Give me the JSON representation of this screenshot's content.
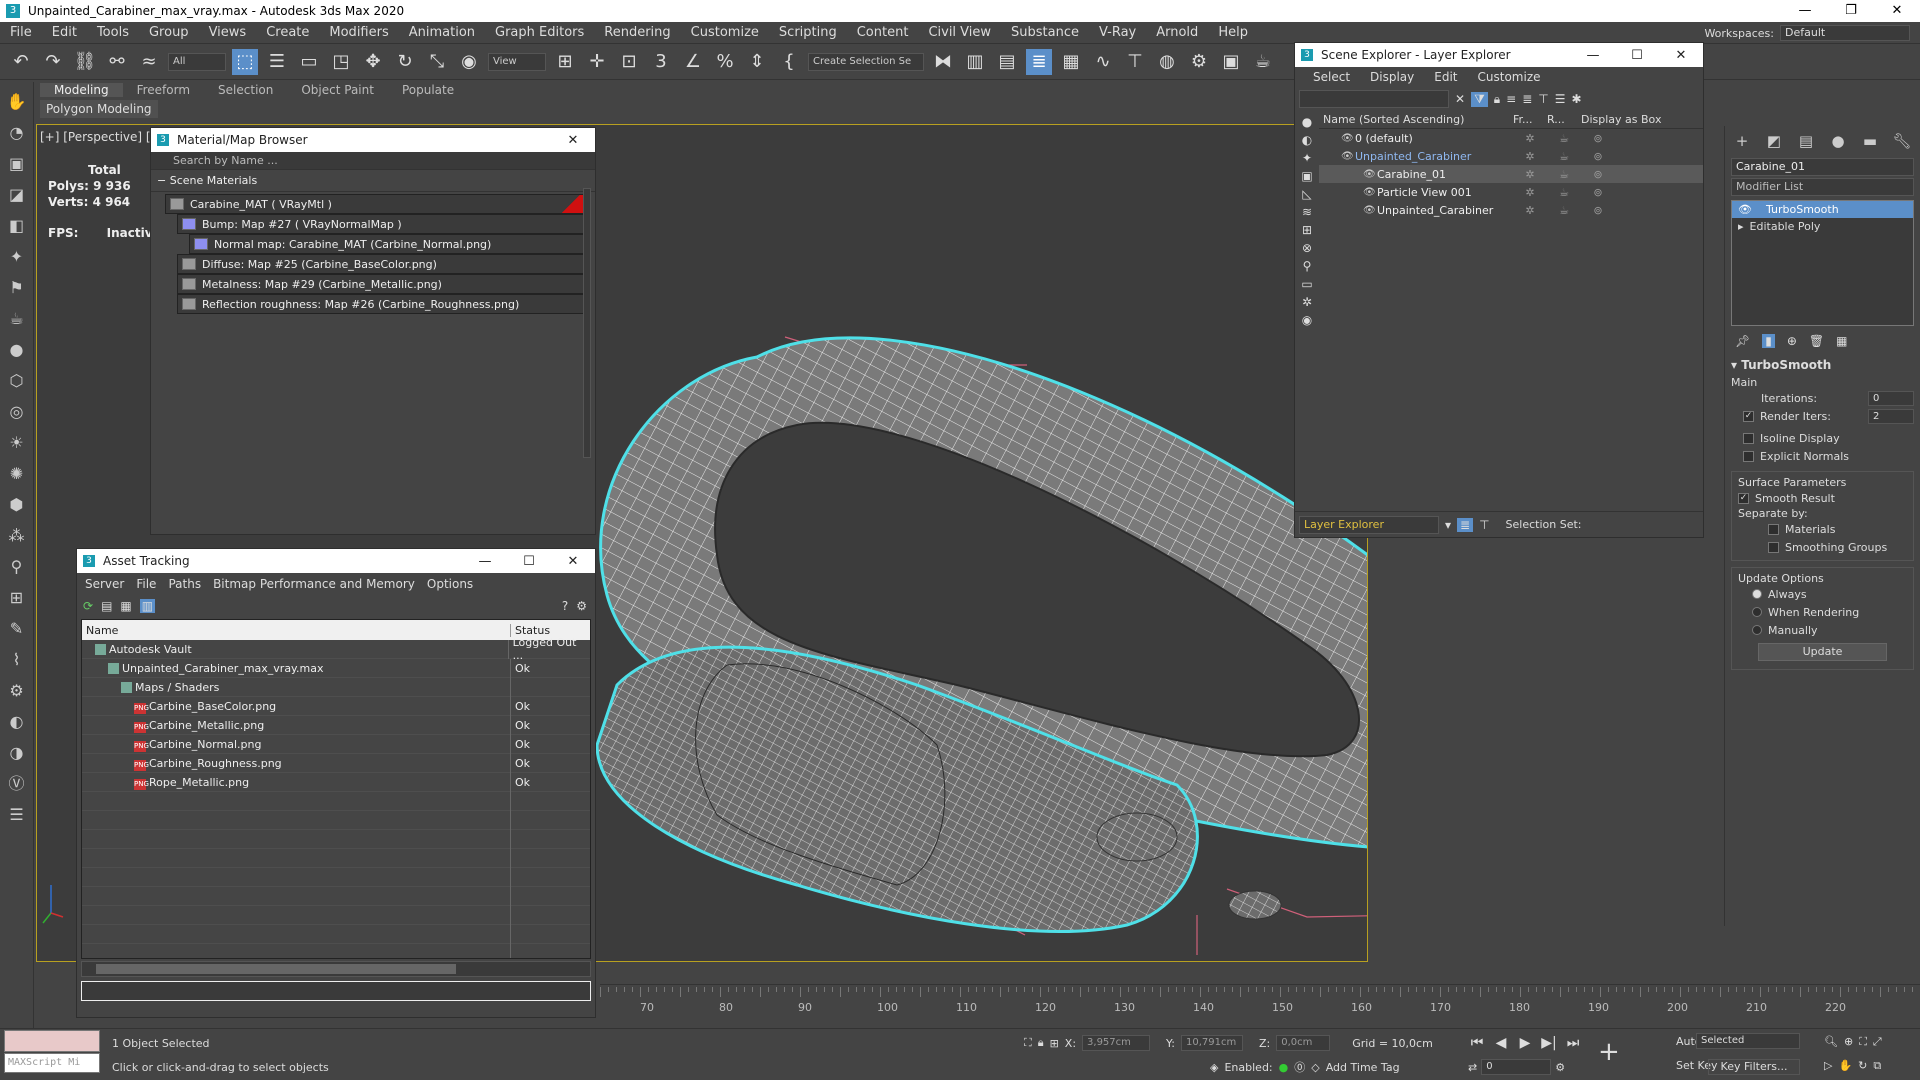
{
  "title": "Unpainted_Carabiner_max_vray.max - Autodesk 3ds Max 2020",
  "menu": [
    "File",
    "Edit",
    "Tools",
    "Group",
    "Views",
    "Create",
    "Modifiers",
    "Animation",
    "Graph Editors",
    "Rendering",
    "Customize",
    "Scripting",
    "Content",
    "Civil View",
    "Substance",
    "V-Ray",
    "Arnold",
    "Help"
  ],
  "workspace": {
    "label": "Workspaces:",
    "value": "Default"
  },
  "toolbar": {
    "filter": "All",
    "view": "View",
    "selection_set": "Create Selection Se"
  },
  "ribbon": {
    "tabs": [
      "Modeling",
      "Freeform",
      "Selection",
      "Object Paint",
      "Populate"
    ],
    "active": "Modeling",
    "sub": "Polygon Modeling"
  },
  "viewport": {
    "label": "[+] [Perspective] [St",
    "stats_total": "Total",
    "polys_label": "Polys:",
    "polys": "9 936",
    "verts_label": "Verts:",
    "verts": "4 964",
    "fps_label": "FPS:",
    "fps": "Inactive"
  },
  "material_browser": {
    "title": "Material/Map Browser",
    "search": "Search by Name ...",
    "section": "Scene Materials",
    "items": [
      {
        "label": "Carabine_MAT  ( VRayMtl )",
        "indent": 0
      },
      {
        "label": "Bump: Map #27  ( VRayNormalMap )",
        "indent": 1
      },
      {
        "label": "Normal map: Carabine_MAT (Carbine_Normal.png)",
        "indent": 2
      },
      {
        "label": "Diffuse: Map #25 (Carbine_BaseColor.png)",
        "indent": 1
      },
      {
        "label": "Metalness: Map #29 (Carbine_Metallic.png)",
        "indent": 1
      },
      {
        "label": "Reflection roughness: Map #26 (Carbine_Roughness.png)",
        "indent": 1
      }
    ]
  },
  "asset_tracking": {
    "title": "Asset Tracking",
    "menu": [
      "Server",
      "File",
      "Paths",
      "Bitmap Performance and Memory",
      "Options"
    ],
    "col_name": "Name",
    "col_status": "Status",
    "rows": [
      {
        "name": "Autodesk Vault",
        "status": "Logged Out ...",
        "indent": 1,
        "png": false
      },
      {
        "name": "Unpainted_Carabiner_max_vray.max",
        "status": "Ok",
        "indent": 2,
        "png": false
      },
      {
        "name": "Maps / Shaders",
        "status": "",
        "indent": 3,
        "png": false
      },
      {
        "name": "Carbine_BaseColor.png",
        "status": "Ok",
        "indent": 4,
        "png": true
      },
      {
        "name": "Carbine_Metallic.png",
        "status": "Ok",
        "indent": 4,
        "png": true
      },
      {
        "name": "Carbine_Normal.png",
        "status": "Ok",
        "indent": 4,
        "png": true
      },
      {
        "name": "Carbine_Roughness.png",
        "status": "Ok",
        "indent": 4,
        "png": true
      },
      {
        "name": "Rope_Metallic.png",
        "status": "Ok",
        "indent": 4,
        "png": true
      }
    ]
  },
  "scene_explorer": {
    "title": "Scene Explorer - Layer Explorer",
    "menu": [
      "Select",
      "Display",
      "Edit",
      "Customize"
    ],
    "col_name": "Name (Sorted Ascending)",
    "col_fr": "Fr...",
    "col_r": "R...",
    "col_box": "Display as Box",
    "rows": [
      {
        "name": "0 (default)",
        "indent": 1,
        "sel": false
      },
      {
        "name": "Unpainted_Carabiner",
        "indent": 1,
        "sel": false,
        "blue": true
      },
      {
        "name": "Carabine_01",
        "indent": 2,
        "sel": true
      },
      {
        "name": "Particle View 001",
        "indent": 2,
        "sel": false
      },
      {
        "name": "Unpainted_Carabiner",
        "indent": 2,
        "sel": false
      }
    ],
    "footer_explorer": "Layer Explorer",
    "footer_selset": "Selection Set:"
  },
  "command_panel": {
    "object_name": "Carabine_01",
    "modifier_list": "Modifier List",
    "stack": [
      "TurboSmooth",
      "Editable Poly"
    ],
    "turbosmooth": {
      "title": "TurboSmooth",
      "main": "Main",
      "iterations_label": "Iterations:",
      "iterations": "0",
      "render_iters_label": "Render Iters:",
      "render_iters": "2",
      "isoline": "Isoline Display",
      "explicit": "Explicit Normals",
      "surface": "Surface Parameters",
      "smooth_result": "Smooth Result",
      "separate": "Separate by:",
      "materials": "Materials",
      "smoothing": "Smoothing Groups",
      "update_options": "Update Options",
      "always": "Always",
      "when_rendering": "When Rendering",
      "manually": "Manually",
      "update": "Update"
    }
  },
  "timeline": {
    "ticks": [
      "70",
      "80",
      "90",
      "100",
      "110",
      "120",
      "130",
      "140",
      "150",
      "160",
      "170",
      "180",
      "190",
      "200",
      "210",
      "220"
    ]
  },
  "status": {
    "selected": "1 Object Selected",
    "hint": "Click or click-and-drag to select objects",
    "maxscript": "MAXScript Mi",
    "x_label": "X:",
    "x": "3,957cm",
    "y_label": "Y:",
    "y": "10,791cm",
    "z_label": "Z:",
    "z": "0,0cm",
    "grid": "Grid = 10,0cm",
    "enabled": "Enabled:",
    "add_time_tag": "Add Time Tag",
    "autokey": "Auto Key",
    "setkey": "Set Key",
    "selected_drop": "Selected",
    "key_filters": "Key Filters...",
    "frame": "0"
  },
  "colors": {
    "accent": "#5b8fc9",
    "viewport_border": "#b8a020",
    "selection": "#4fe0e8"
  }
}
